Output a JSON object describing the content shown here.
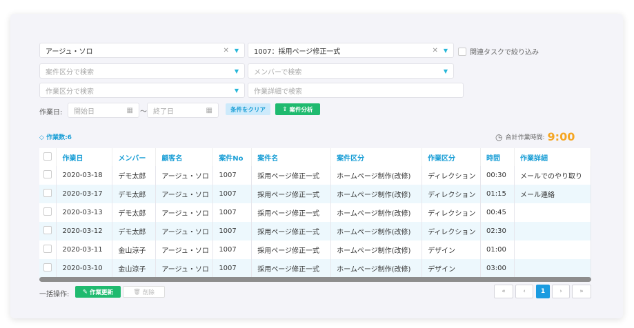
{
  "filters": {
    "customer": "アージュ・ソロ",
    "project": "1007：採用ページ修正一式",
    "related_task_label": "関連タスクで絞り込み",
    "project_type_placeholder": "案件区分で検索",
    "member_placeholder": "メンバーで検索",
    "work_type_placeholder": "作業区分で検索",
    "work_detail_placeholder": "作業詳細で検索",
    "work_date_label": "作業日:",
    "start_placeholder": "開始日",
    "tilde": "〜",
    "end_placeholder": "終了日",
    "clear_label": "条件をクリア",
    "analyze_label": "案件分析"
  },
  "summary": {
    "count_label": "作業数:6",
    "total_label": "合計作業時間:",
    "total_value": "9:00"
  },
  "table": {
    "headers": [
      "作業日",
      "メンバー",
      "顧客名",
      "案件No",
      "案件名",
      "案件区分",
      "作業区分",
      "時間",
      "作業詳細"
    ],
    "rows": [
      [
        "2020-03-18",
        "デモ太郎",
        "アージュ・ソロ",
        "1007",
        "採用ページ修正一式",
        "ホームページ制作(改修)",
        "ディレクション",
        "00:30",
        "メールでのやり取り"
      ],
      [
        "2020-03-17",
        "デモ太郎",
        "アージュ・ソロ",
        "1007",
        "採用ページ修正一式",
        "ホームページ制作(改修)",
        "ディレクション",
        "01:15",
        "メール連絡"
      ],
      [
        "2020-03-13",
        "デモ太郎",
        "アージュ・ソロ",
        "1007",
        "採用ページ修正一式",
        "ホームページ制作(改修)",
        "ディレクション",
        "00:45",
        ""
      ],
      [
        "2020-03-12",
        "デモ太郎",
        "アージュ・ソロ",
        "1007",
        "採用ページ修正一式",
        "ホームページ制作(改修)",
        "ディレクション",
        "02:30",
        ""
      ],
      [
        "2020-03-11",
        "金山涼子",
        "アージュ・ソロ",
        "1007",
        "採用ページ修正一式",
        "ホームページ制作(改修)",
        "デザイン",
        "01:00",
        ""
      ],
      [
        "2020-03-10",
        "金山涼子",
        "アージュ・ソロ",
        "1007",
        "採用ページ修正一式",
        "ホームページ制作(改修)",
        "デザイン",
        "03:00",
        ""
      ]
    ]
  },
  "bulk": {
    "label": "一括操作:",
    "update_label": "作業更新",
    "delete_label": "削除"
  },
  "pagination": {
    "first": "«",
    "prev": "‹",
    "current": "1",
    "next": "›",
    "last": "»"
  },
  "colors": {
    "accent": "#1c9fd6",
    "green": "#1fba6f",
    "orange": "#f5a623"
  }
}
